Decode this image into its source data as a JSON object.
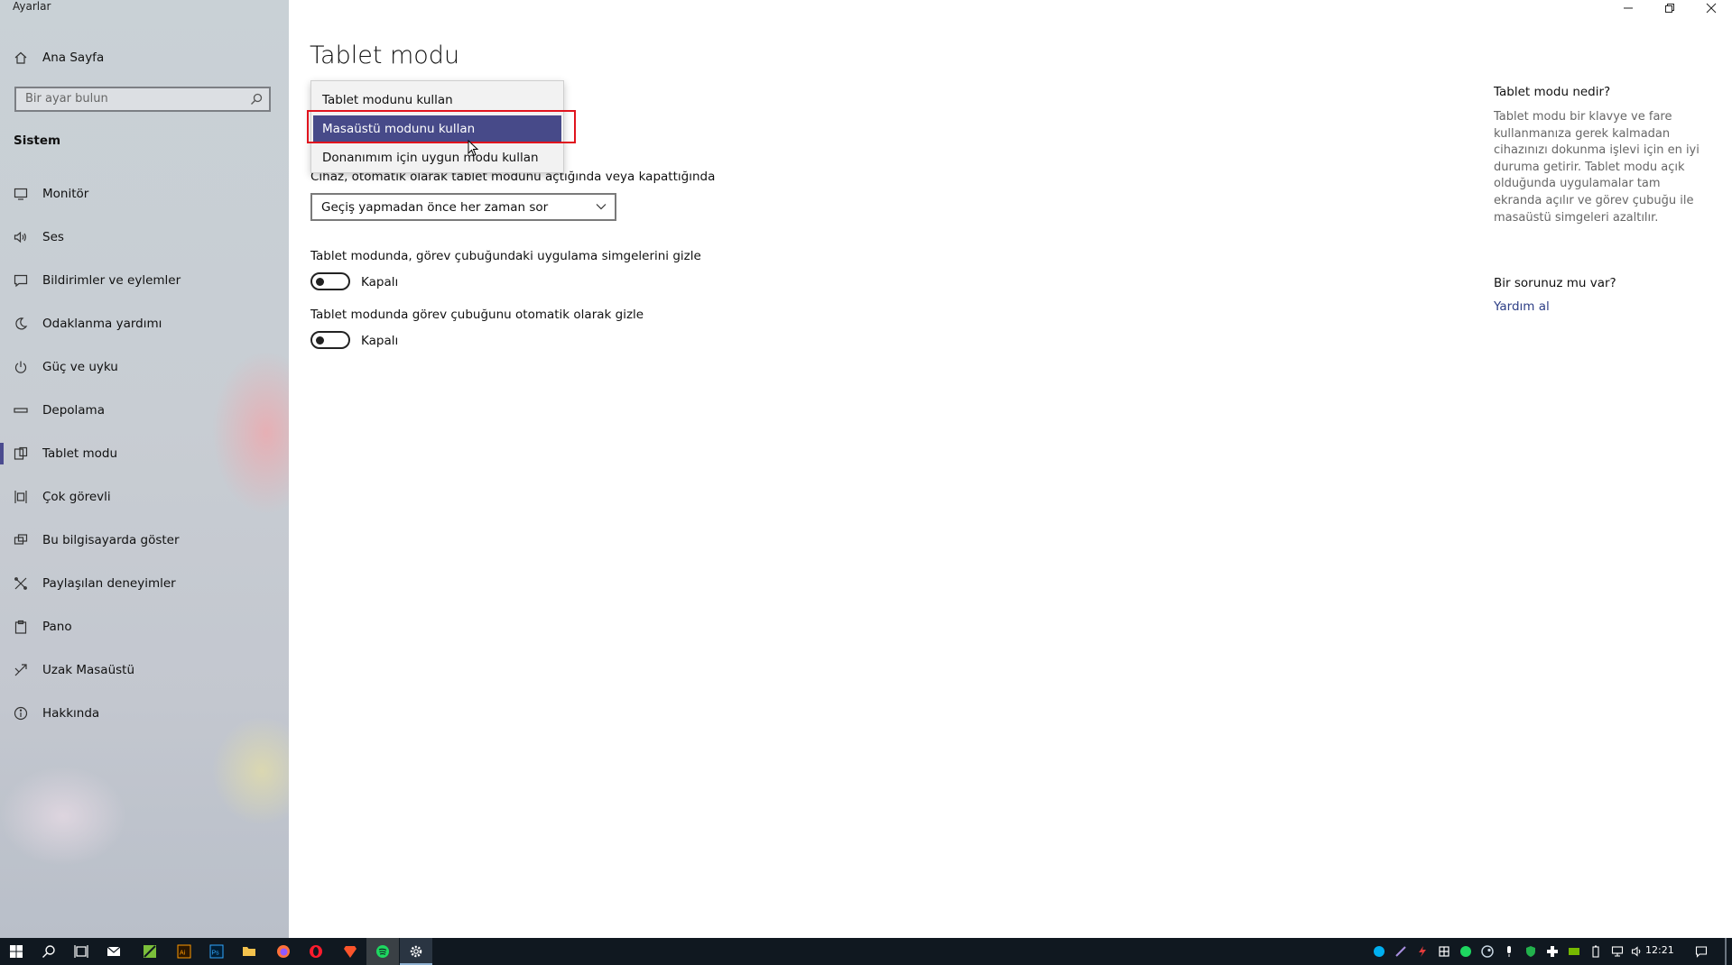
{
  "window": {
    "app_title": "Ayarlar",
    "controls": [
      "minimize-icon",
      "restore-icon",
      "close-icon"
    ]
  },
  "sidebar": {
    "home_label": "Ana Sayfa",
    "search_placeholder": "Bir ayar bulun",
    "section_title": "Sistem",
    "items": [
      {
        "label": "Monitör",
        "icon": "monitor-icon"
      },
      {
        "label": "Ses",
        "icon": "speaker-icon"
      },
      {
        "label": "Bildirimler ve eylemler",
        "icon": "notification-icon"
      },
      {
        "label": "Odaklanma yardımı",
        "icon": "moon-icon"
      },
      {
        "label": "Güç ve uyku",
        "icon": "power-icon"
      },
      {
        "label": "Depolama",
        "icon": "storage-icon"
      },
      {
        "label": "Tablet modu",
        "icon": "tablet-mode-icon",
        "active": true
      },
      {
        "label": "Çok görevli",
        "icon": "multitasking-icon"
      },
      {
        "label": "Bu bilgisayarda göster",
        "icon": "project-icon"
      },
      {
        "label": "Paylaşılan deneyimler",
        "icon": "shared-experiences-icon"
      },
      {
        "label": "Pano",
        "icon": "clipboard-icon"
      },
      {
        "label": "Uzak Masaüstü",
        "icon": "remote-desktop-icon"
      },
      {
        "label": "Hakkında",
        "icon": "info-icon"
      }
    ]
  },
  "main": {
    "page_title": "Tablet modu",
    "dropdown_options": [
      "Tablet modunu kullan",
      "Masaüstü modunu kullan",
      "Donanımım için uygun modu kullan"
    ],
    "selected_option": "Masaüstü modunu kullan",
    "switch_label": "Cihaz, otomatik olarak tablet modunu açtığında veya kapattığında",
    "switch_value": "Geçiş yapmadan önce her zaman sor",
    "hide_icons_label": "Tablet modunda, görev çubuğundaki uygulama simgelerini gizle",
    "hide_icons_state": "Kapalı",
    "autohide_label": "Tablet modunda görev çubuğunu otomatik olarak gizle",
    "autohide_state": "Kapalı"
  },
  "right_pane": {
    "about_title": "Tablet modu nedir?",
    "about_text": "Tablet modu bir klavye ve fare kullanmanıza gerek kalmadan cihazınızı dokunma işlevi için en iyi duruma getirir. Tablet modu açık olduğunda uygulamalar tam ekranda açılır ve görev çubuğu ile masaüstü simgeleri azaltılır.",
    "question_title": "Bir sorunuz mu var?",
    "help_link": "Yardım al"
  },
  "taskbar": {
    "apps": [
      "windows-start-icon",
      "search-icon",
      "task-view-icon",
      "mail-icon",
      "green-app-icon",
      "illustrator-icon",
      "photoshop-icon",
      "file-explorer-icon",
      "firefox-icon",
      "opera-icon",
      "brave-icon",
      "spotify-icon",
      "settings-gear-icon"
    ],
    "clock": "12:21"
  },
  "colors": {
    "accent": "#474a89",
    "highlight_box": "#e0141e",
    "link": "#2e3f86"
  }
}
